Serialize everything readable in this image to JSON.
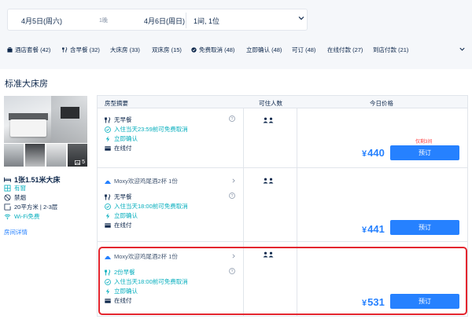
{
  "search": {
    "checkin": "4月5日(周六)",
    "nights": "1晚",
    "checkout": "4月6日(周日)",
    "guests": "1间, 1位"
  },
  "filters": [
    {
      "label": "酒店套餐 (42)",
      "icon": "package-icon"
    },
    {
      "label": "含早餐 (32)",
      "icon": "utensils-icon"
    },
    {
      "label": "大床房 (33)",
      "icon": ""
    },
    {
      "label": "双床房 (15)",
      "icon": ""
    },
    {
      "label": "免费取消 (48)",
      "icon": "check-circle-icon"
    },
    {
      "label": "立即确认 (48)",
      "icon": ""
    },
    {
      "label": "可订 (48)",
      "icon": ""
    },
    {
      "label": "在线付款 (27)",
      "icon": ""
    },
    {
      "label": "到店付款 (21)",
      "icon": ""
    }
  ],
  "room": {
    "title": "标准大床房",
    "photo_count": "5",
    "bed": "1张1.51米大床",
    "window": "有窗",
    "smoking": "禁烟",
    "size": "20平方米 | 2-3层",
    "wifi": "Wi-Fi免费",
    "details_link": "房间详情"
  },
  "table": {
    "headers": {
      "summary": "房型摘要",
      "occupancy": "可住人数",
      "price": "今日价格"
    },
    "currency": "¥",
    "rows": [
      {
        "package": "",
        "meal": "无早餐",
        "cancel": "入住当天23:59前可免费取消",
        "confirm": "立即确认",
        "payment": "在线付",
        "price": "440",
        "remaining": "仅剩3间",
        "book_label": "预订"
      },
      {
        "package": "Moxy欢迎鸡尾酒2杯 1份",
        "meal": "无早餐",
        "cancel": "入住当天18:00前可免费取消",
        "confirm": "立即确认",
        "payment": "在线付",
        "price": "441",
        "remaining": "",
        "book_label": "预订"
      },
      {
        "package": "Moxy欢迎鸡尾酒2杯 1份",
        "meal": "2份早餐",
        "cancel": "入住当天18:00前可免费取消",
        "confirm": "立即确认",
        "payment": "在线付",
        "price": "531",
        "remaining": "",
        "book_label": "预订"
      }
    ]
  },
  "colors": {
    "accent": "#2681ff",
    "green": "#06aebd",
    "highlight": "#e3262f",
    "text": "#0f294d"
  }
}
